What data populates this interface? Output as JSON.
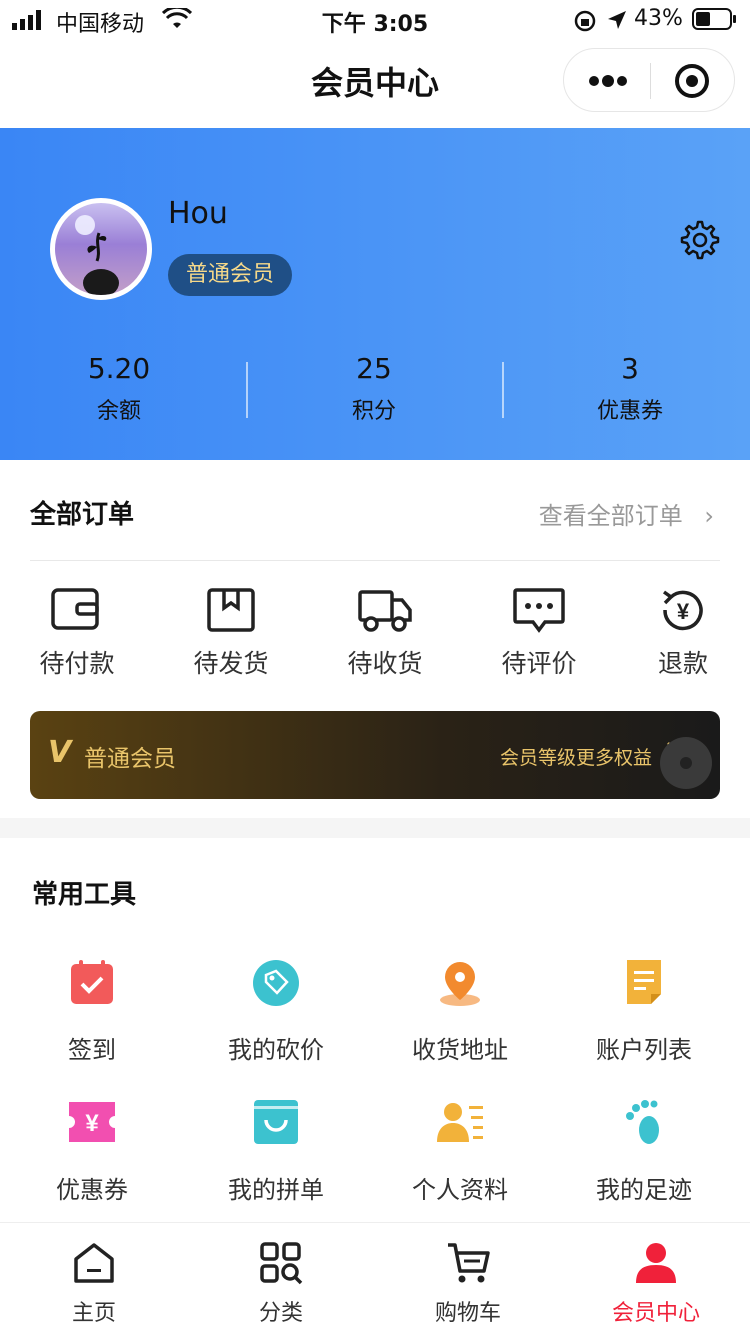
{
  "status_bar": {
    "carrier": "中国移动",
    "time": "下午 3:05",
    "battery": "43%"
  },
  "nav": {
    "title": "会员中心"
  },
  "profile": {
    "username": "Hou",
    "level": "普通会员",
    "stats": [
      {
        "value": "5.20",
        "label": "余额"
      },
      {
        "value": "25",
        "label": "积分"
      },
      {
        "value": "3",
        "label": "优惠券"
      }
    ]
  },
  "orders": {
    "title": "全部订单",
    "see_all": "查看全部订单",
    "items": [
      {
        "label": "待付款",
        "icon": "wallet-icon"
      },
      {
        "label": "待发货",
        "icon": "box-icon"
      },
      {
        "label": "待收货",
        "icon": "truck-icon"
      },
      {
        "label": "待评价",
        "icon": "chat-icon"
      },
      {
        "label": "退款",
        "icon": "refund-icon"
      }
    ]
  },
  "vip": {
    "badge": "V",
    "name": "普通会员",
    "more": "会员等级更多权益"
  },
  "tools": {
    "title": "常用工具",
    "items": [
      {
        "label": "签到",
        "icon": "calendar-check-icon",
        "color": "#f25a5a"
      },
      {
        "label": "我的砍价",
        "icon": "price-tag-icon",
        "color": "#3cc2cf"
      },
      {
        "label": "收货地址",
        "icon": "location-pin-icon",
        "color": "#f28a2e"
      },
      {
        "label": "账户列表",
        "icon": "document-icon",
        "color": "#f2b23a"
      },
      {
        "label": "优惠券",
        "icon": "coupon-icon",
        "color": "#f24fb0"
      },
      {
        "label": "我的拼单",
        "icon": "shopping-bag-icon",
        "color": "#3cc2cf"
      },
      {
        "label": "个人资料",
        "icon": "profile-card-icon",
        "color": "#f2b23a"
      },
      {
        "label": "我的足迹",
        "icon": "footprint-icon",
        "color": "#3cc2cf"
      }
    ]
  },
  "tabbar": {
    "items": [
      {
        "label": "主页",
        "icon": "home-icon"
      },
      {
        "label": "分类",
        "icon": "category-icon"
      },
      {
        "label": "购物车",
        "icon": "cart-icon"
      },
      {
        "label": "会员中心",
        "icon": "member-icon"
      }
    ],
    "active_color": "#f0213a"
  }
}
